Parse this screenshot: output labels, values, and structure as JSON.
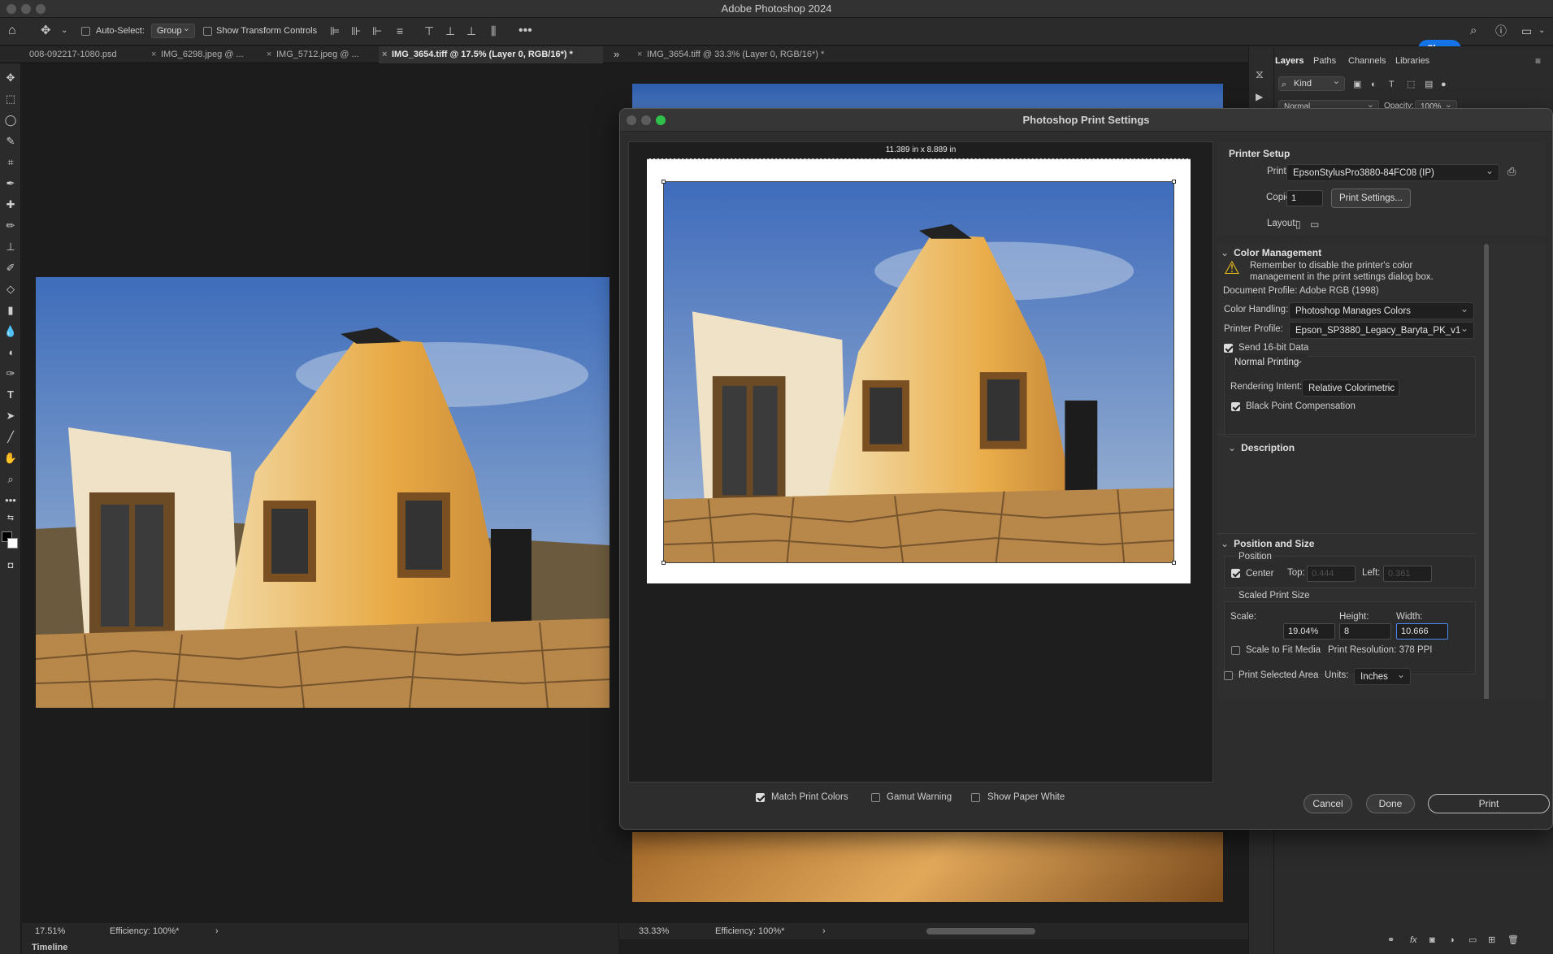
{
  "app": {
    "title": "Adobe Photoshop 2024"
  },
  "options": {
    "auto_select_label": "Auto-Select:",
    "auto_select_value": "Group",
    "show_transform_label": "Show Transform Controls",
    "share_label": "Share"
  },
  "tabs": [
    {
      "label": "008-092217-1080.psd"
    },
    {
      "label": "IMG_6298.jpeg @ ..."
    },
    {
      "label": "IMG_5712.jpeg @ ..."
    },
    {
      "label": "IMG_3654.tiff @ 17.5% (Layer 0, RGB/16*) *"
    },
    {
      "label": "IMG_3654.tiff @ 33.3% (Layer 0, RGB/16*) *"
    }
  ],
  "left_status": {
    "zoom": "17.51%",
    "efficiency": "Efficiency: 100%*",
    "timeline": "Timeline"
  },
  "right_status": {
    "zoom": "33.33%",
    "efficiency": "Efficiency: 100%*"
  },
  "panel": {
    "tabs": [
      "Layers",
      "Paths",
      "Channels",
      "Libraries"
    ],
    "filter": "Kind",
    "blend": "Normal",
    "opacity_label": "Opacity:",
    "opacity_value": "100%"
  },
  "dialog": {
    "title": "Photoshop Print Settings",
    "dims": "11.389 in x 8.889 in",
    "printer_setup": {
      "header": "Printer Setup",
      "printer_label": "Printer:",
      "printer_value": "EpsonStylusPro3880-84FC08 (IP)",
      "copies_label": "Copies:",
      "copies_value": "1",
      "print_settings_label": "Print Settings...",
      "layout_label": "Layout:"
    },
    "color": {
      "header": "Color Management",
      "warning": "Remember to disable the printer's color management in the print settings dialog box.",
      "doc_profile": "Document Profile: Adobe RGB (1998)",
      "handling_label": "Color Handling:",
      "handling_value": "Photoshop Manages Colors",
      "profile_label": "Printer Profile:",
      "profile_value": "Epson_SP3880_Legacy_Baryta_PK_v1",
      "send16": "Send 16-bit Data",
      "normal_printing": "Normal Printing",
      "intent_label": "Rendering Intent:",
      "intent_value": "Relative Colorimetric",
      "bpc": "Black Point Compensation"
    },
    "description": {
      "header": "Description"
    },
    "position": {
      "header": "Position and Size",
      "position_label": "Position",
      "center": "Center",
      "top_label": "Top:",
      "top_value": "0.444",
      "left_label": "Left:",
      "left_value": "0.361",
      "scaled_label": "Scaled Print Size",
      "scale_label": "Scale:",
      "scale_value": "19.04%",
      "height_label": "Height:",
      "height_value": "8",
      "width_label": "Width:",
      "width_value": "10.666",
      "scale_fit": "Scale to Fit Media",
      "resolution": "Print Resolution: 378 PPI",
      "print_selected": "Print Selected Area",
      "units_label": "Units:",
      "units_value": "Inches"
    },
    "footer": {
      "match": "Match Print Colors",
      "gamut": "Gamut Warning",
      "paper_white": "Show Paper White",
      "cancel": "Cancel",
      "done": "Done",
      "print": "Print"
    }
  },
  "colors": {
    "accent": "#1473e6",
    "bg": "#1e1e1e",
    "panel": "#2b2b2b",
    "warn": "#f5c518"
  }
}
